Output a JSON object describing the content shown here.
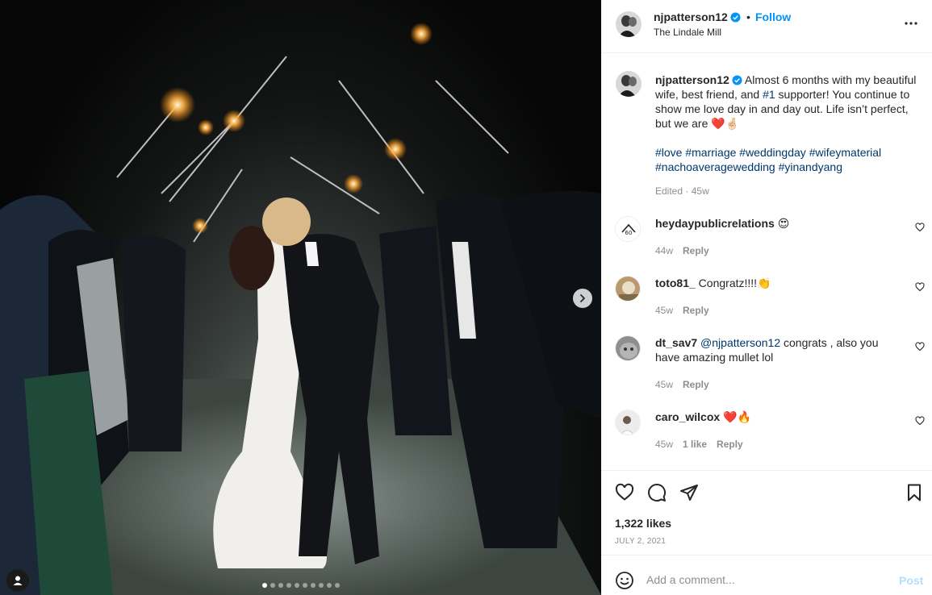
{
  "post": {
    "username": "njpatterson12",
    "verified": true,
    "bullet": "•",
    "follow_label": "Follow",
    "location": "The Lindale Mill",
    "more_icon": "more-horizontal-icon"
  },
  "caption": {
    "username": "njpatterson12",
    "text_part1": " Almost 6 months with my beautiful wife, best friend, and ",
    "mention": "#1",
    "text_part2": " supporter! You continue to show me love day in and day out. Life isn’t perfect, but we are ",
    "emojis": "❤️🤞🏻",
    "hashtags": [
      "#love",
      "#marriage",
      "#weddingday",
      "#wifeymaterial",
      "#nachoaverагewedding",
      "#yinandyang"
    ],
    "edited": "Edited",
    "dot": "·",
    "time": "45w"
  },
  "comments": [
    {
      "username": "heydaypublicrelations",
      "mention": "",
      "text": " 😍",
      "time": "44w",
      "likes": "",
      "reply": "Reply"
    },
    {
      "username": "toto81_",
      "mention": "",
      "text": " Congratz!!!!👏",
      "time": "45w",
      "likes": "",
      "reply": "Reply"
    },
    {
      "username": "dt_sav7",
      "mention": "@njpatterson12",
      "text": " congrats , also you have amazing mullet lol",
      "time": "45w",
      "likes": "",
      "reply": "Reply"
    },
    {
      "username": "caro_wilcox",
      "mention": "",
      "text": " ❤️🔥",
      "time": "45w",
      "likes": "1 like",
      "reply": "Reply"
    }
  ],
  "actions": {
    "likes": "1,322 likes",
    "date": "JULY 2, 2021",
    "icons": [
      "heart-icon",
      "comment-icon",
      "share-icon",
      "bookmark-icon"
    ]
  },
  "add_comment": {
    "placeholder": "Add a comment...",
    "post_label": "Post"
  },
  "carousel": {
    "slides": 10,
    "active": 0
  },
  "colors": {
    "link": "#0095f6",
    "hashtag": "#00376b",
    "muted": "#8e8e8e",
    "post_disabled": "#b2dffc"
  }
}
